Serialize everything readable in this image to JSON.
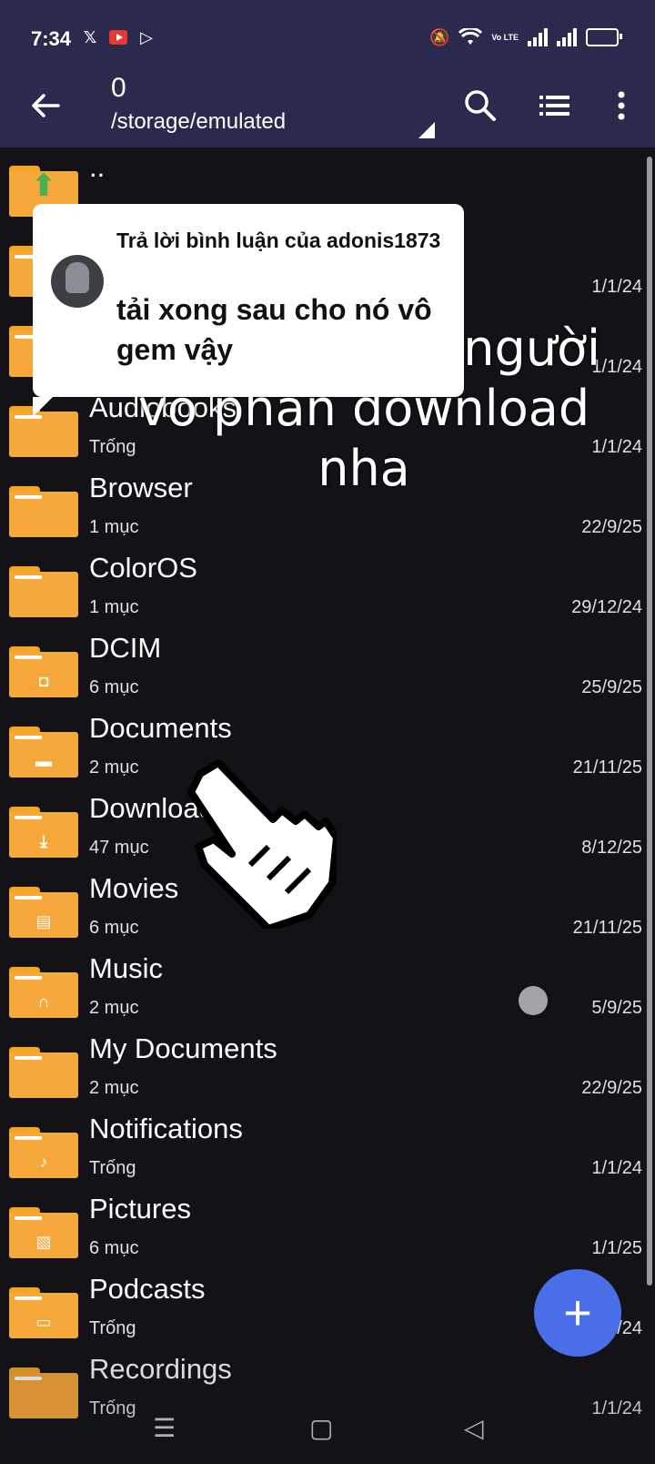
{
  "status_bar": {
    "time": "7:34",
    "left_icons": [
      "x-icon",
      "youtube-icon",
      "play-store-icon"
    ],
    "right_icons": [
      "mute-icon",
      "wifi-icon",
      "volte-icon",
      "signal-icon",
      "signal-icon",
      "battery-icon"
    ],
    "volte_text": "Vo LTE"
  },
  "app_bar": {
    "count": "0",
    "path": "/storage/emulated"
  },
  "files": [
    {
      "name": "..",
      "sub": "",
      "date": "",
      "glyph": "up-arrow"
    },
    {
      "name": "",
      "sub": "",
      "date": "1/1/24",
      "glyph": ""
    },
    {
      "name": "",
      "sub": "",
      "date": "1/1/24",
      "glyph": ""
    },
    {
      "name": "Audiobooks",
      "sub": "Trống",
      "date": "1/1/24",
      "glyph": ""
    },
    {
      "name": "Browser",
      "sub": "1 mục",
      "date": "22/9/25",
      "glyph": ""
    },
    {
      "name": "ColorOS",
      "sub": "1 mục",
      "date": "29/12/24",
      "glyph": ""
    },
    {
      "name": "DCIM",
      "sub": "6 mục",
      "date": "25/9/25",
      "glyph": "camera"
    },
    {
      "name": "Documents",
      "sub": "2 mục",
      "date": "21/11/25",
      "glyph": "briefcase"
    },
    {
      "name": "Download",
      "sub": "47 mục",
      "date": "8/12/25",
      "glyph": "download"
    },
    {
      "name": "Movies",
      "sub": "6 mục",
      "date": "21/11/25",
      "glyph": "clapper"
    },
    {
      "name": "Music",
      "sub": "2 mục",
      "date": "5/9/25",
      "glyph": "headphones"
    },
    {
      "name": "My Documents",
      "sub": "2 mục",
      "date": "22/9/25",
      "glyph": ""
    },
    {
      "name": "Notifications",
      "sub": "Trống",
      "date": "1/1/24",
      "glyph": "bell"
    },
    {
      "name": "Pictures",
      "sub": "6 mục",
      "date": "1/1/25",
      "glyph": "image"
    },
    {
      "name": "Podcasts",
      "sub": "Trống",
      "date": "1/1/24",
      "glyph": "chat"
    },
    {
      "name": "Recordings",
      "sub": "Trống",
      "date": "1/1/24",
      "glyph": ""
    }
  ],
  "comment": {
    "header": "Trả lời bình luận của adonis1873",
    "body": "tải xong sau cho nó vô gem vậy"
  },
  "caption": {
    "line1": "người",
    "line2": "vô phần download",
    "line3": "nha"
  },
  "fab": {
    "label": "+"
  },
  "colors": {
    "app_bar": "#2a2a4e",
    "background": "#121217",
    "folder": "#f7a83a",
    "fab": "#4a6ee8"
  }
}
